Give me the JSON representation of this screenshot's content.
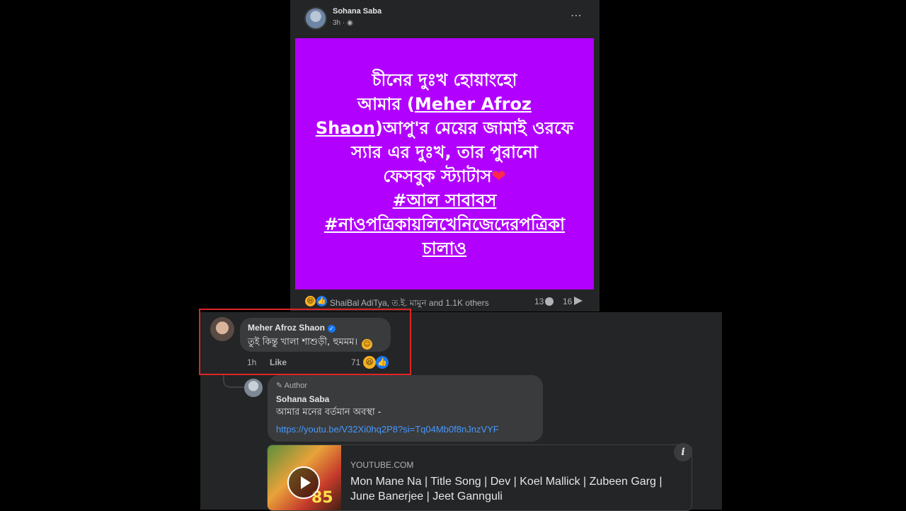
{
  "post": {
    "author": "Sohana Saba",
    "time": "3h ·",
    "more_icon": "⋯",
    "image_text": {
      "line1": "চীনের দুঃখ হোয়াংহো",
      "line2_prefix": "আমার (",
      "line2_link": "Meher Afroz",
      "line3_link": "Shaon",
      "line3_rest": ")আপু'র মেয়ের জামাই ওরফে",
      "line4": "স্যার এর দুঃখ, তার পুরানো",
      "line5": "ফেসবুক স্ট্যাটাস",
      "heart": "❤",
      "hashtag1": "#আল সাবাবস",
      "hashtag2": "#নাওপত্রিকায়লিখেনিজেদেরপত্রিকা",
      "hashtag2_cont": "চালাও"
    },
    "image_bg_color": "#b200ff",
    "reaction_names": "ShaiBal AdiTya, ত.ই. মামুন and 1.1K others",
    "comment_count": "13",
    "share_count": "16"
  },
  "comments": [
    {
      "name": "Meher Afroz Shaon",
      "verified": "✓",
      "text": "তুই কিন্তু খালা শাশুড়ী, হুমমম।",
      "emoji": "☺",
      "time": "1h",
      "like_label": "Like",
      "reaction_count": "71"
    },
    {
      "badge": "✎ Author",
      "name": "Sohana Saba",
      "text": "আমার মনের বর্তমান অবস্থা -",
      "link": "https://youtu.be/V32Xi0hq2P8?si=Tq04Mb0f8nJnzVYF"
    }
  ],
  "link_preview": {
    "domain": "YOUTUBE.COM",
    "title": "Mon Mane Na | Title Song | Dev | Koel Mallick | Zubeen Garg | June Banerjee | Jeet Gannguli",
    "thumb_badge": "85",
    "info_label": "i"
  },
  "colors": {
    "highlight": "#e02424",
    "link": "#4599ff",
    "like_blue": "#1877f2",
    "haha_yellow": "#f7b125"
  }
}
